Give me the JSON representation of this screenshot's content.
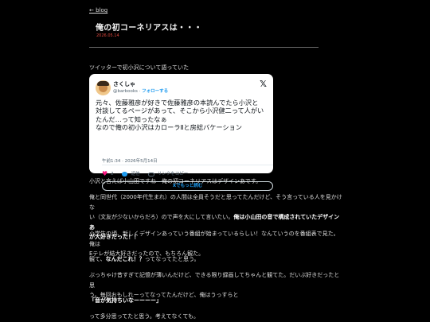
{
  "nav": {
    "back_label": "← blog"
  },
  "post": {
    "title": "俺の初コーネリアスは・・・",
    "date": "2026.05.14",
    "intro": "ツイッターで初小沢について語っていた"
  },
  "tweet": {
    "user_name": "さくしゃ",
    "handle": "@barbooks",
    "dot": " · ",
    "follow_label": "フォローする",
    "x_logo": "𝕏",
    "lines": [
      "元々、佐藤雅彦が好きで佐藤雅彦の本読んでたら小沢と",
      "対談してるページがあって、そこから小沢健二って人がい",
      "たんだ…って知ったなぁ",
      "なので俺の初小沢はカローラⅡと房総バケーション"
    ],
    "timestamp": "午前1:34 · 2026年5月14日",
    "likes": "2",
    "reply_label": "返信",
    "copy_link_label": "リンクをコピー",
    "read_on_x_label": "Xでもっと読む"
  },
  "body": {
    "p1": "小沢と言えば小山田ですね　俺の初コーネリアスはデザインあです。",
    "p2_line1": "俺と同世代（2000年代生まれ）の人間は全員そうだと思ってたんだけど、そう言っている人を見かけな",
    "p2_line2a": "い（文友が少ないからだろ）ので声を大にして言いたい。",
    "p2_bold_a": "俺は小山田の音で構成されていたデザインあ",
    "p2_bold_b": "が大好きだった！！",
    "p3_line1": "小学生の頃、新しくデザインあっていう番組が始まっているらしい！なんていうのを番組表で見た。俺は",
    "p3_line2": "Eテレが結大好きだったので、もちろん観た。",
    "p4_pre": "観て、",
    "p4_bold": "なんだこれ！？",
    "p4_post": "ってなってたと思う。",
    "p5_line1": "ぶっちゃけ昔すぎて記憶が薄いんだけど、できる限り録画してちゃんと観てた。だいぶ好きだったと思",
    "p5_line2": "う。毎回おもしれーってなってたんだけど、俺はうっすらと",
    "p6_bold": "「音が気持ちいなーーーー」",
    "p7": "って多分思ってたと思う。考えてなくても。"
  }
}
